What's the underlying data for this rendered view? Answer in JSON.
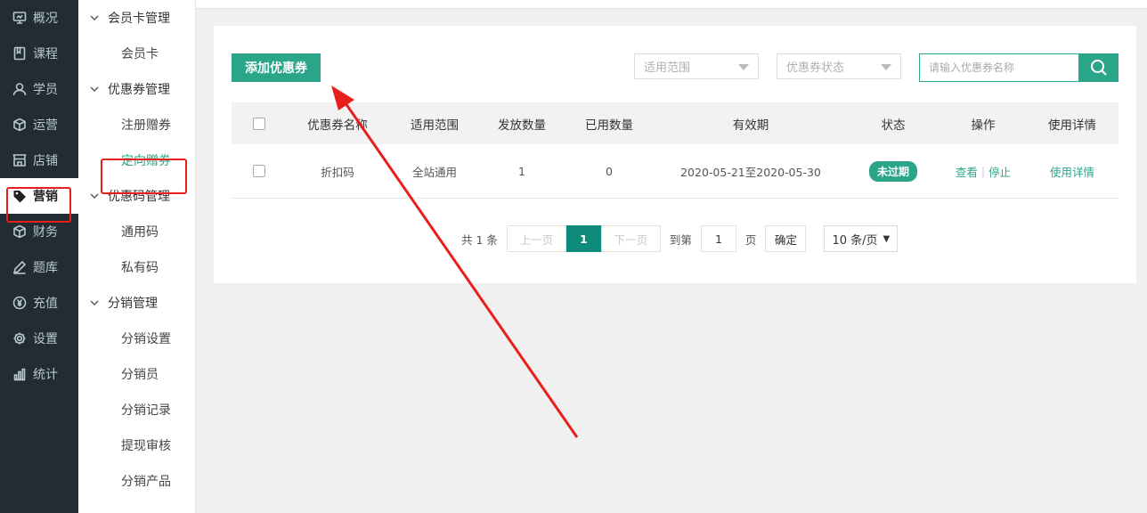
{
  "nav": [
    {
      "label": "概况",
      "icon": "monitor-icon",
      "active": false
    },
    {
      "label": "课程",
      "icon": "book-icon",
      "active": false
    },
    {
      "label": "学员",
      "icon": "user-icon",
      "active": false
    },
    {
      "label": "运营",
      "icon": "cube-icon",
      "active": false
    },
    {
      "label": "店铺",
      "icon": "store-icon",
      "active": false
    },
    {
      "label": "营销",
      "icon": "tag-icon",
      "active": true
    },
    {
      "label": "财务",
      "icon": "cube-icon",
      "active": false
    },
    {
      "label": "题库",
      "icon": "pencil-icon",
      "active": false
    },
    {
      "label": "充值",
      "icon": "yen-icon",
      "active": false
    },
    {
      "label": "设置",
      "icon": "gear-icon",
      "active": false
    },
    {
      "label": "统计",
      "icon": "bar-chart-icon",
      "active": false
    }
  ],
  "subnav": {
    "g1": "会员卡管理",
    "g1_items": [
      "会员卡"
    ],
    "g2": "优惠券管理",
    "g2_items": [
      "注册赠券",
      "定向赠券"
    ],
    "g3": "优惠码管理",
    "g3_items": [
      "通用码",
      "私有码"
    ],
    "g4": "分销管理",
    "g4_items": [
      "分销设置",
      "分销员",
      "分销记录",
      "提现审核",
      "分销产品"
    ]
  },
  "toolbar": {
    "add_label": "添加优惠券",
    "scope_placeholder": "适用范围",
    "status_placeholder": "优惠券状态",
    "search_placeholder": "请输入优惠券名称"
  },
  "table": {
    "headers": [
      "优惠券名称",
      "适用范围",
      "发放数量",
      "已用数量",
      "有效期",
      "状态",
      "操作",
      "使用详情"
    ],
    "rows": [
      {
        "name": "折扣码",
        "scope": "全站通用",
        "issued": "1",
        "used": "0",
        "period": "2020-05-21至2020-05-30",
        "status": "未过期",
        "action_view": "查看",
        "action_sep": "|",
        "action_stop": "停止",
        "detail": "使用详情"
      }
    ]
  },
  "pager": {
    "total": "共 1 条",
    "prev": "上一页",
    "current": "1",
    "next": "下一页",
    "goto": "到第",
    "page_value": "1",
    "page_unit": "页",
    "confirm": "确定",
    "page_size": "10 条/页"
  },
  "colors": {
    "brand": "#2aa58a",
    "sidebar": "#222d32",
    "annotation": "#e8201b"
  }
}
